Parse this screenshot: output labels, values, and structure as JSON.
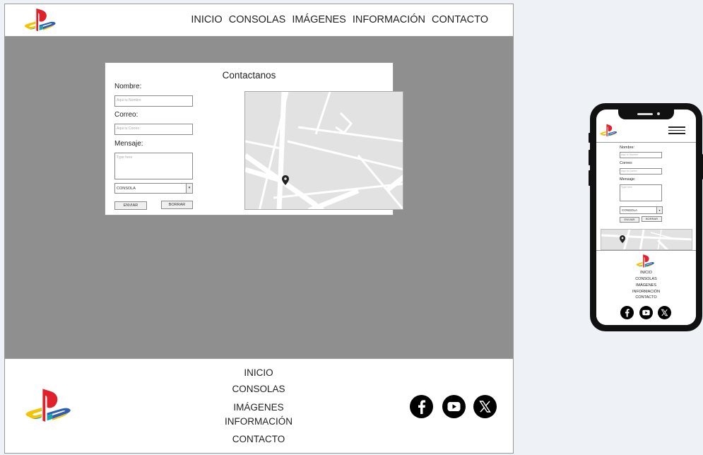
{
  "desktop": {
    "header": {
      "logo_icon": "playstation-logo-icon",
      "nav": [
        "INICIO",
        "CONSOLAS",
        "IMÁGENES",
        "INFORMACIÓN",
        "CONTACTO"
      ]
    },
    "form": {
      "title": "Contactanos",
      "name_label": "Nombre:",
      "name_placeholder": "Aqui tu Nombre",
      "email_label": "Correo:",
      "email_placeholder": "Aqui tu Correo",
      "message_label": "Mensaje:",
      "message_placeholder": "Type here",
      "select_value": "CONSOLA",
      "send_label": "ENVIAR",
      "clear_label": "BORRAR"
    },
    "map_icon": "location-pin-icon",
    "footer": {
      "logo_icon": "playstation-logo-icon",
      "links": [
        "INICIO",
        "CONSOLAS",
        "IMÁGENES",
        "INFORMACIÓN",
        "CONTACTO"
      ],
      "social_icons": [
        "facebook-icon",
        "youtube-icon",
        "x-twitter-icon"
      ]
    }
  },
  "mobile": {
    "header": {
      "logo_icon": "playstation-logo-icon",
      "menu_icon": "hamburger-menu-icon"
    },
    "form": {
      "name_label": "Nombre:",
      "name_placeholder": "Aqui tu Nombre",
      "email_label": "Correo:",
      "email_placeholder": "Aqui tu Correo",
      "message_label": "Mensaje:",
      "message_placeholder": "Type here",
      "select_value": "CONSOLA",
      "send_label": "ENVIAR",
      "clear_label": "BORRAR"
    },
    "footer": {
      "links": [
        "INICIO",
        "CONSOLAS",
        "IMÁGENES",
        "INFORMACIÓN",
        "CONTACTO"
      ],
      "social_icons": [
        "facebook-icon",
        "youtube-icon",
        "x-twitter-icon"
      ]
    }
  },
  "colors": {
    "page_bg": "#eef1f6",
    "main_bg": "#8f8f8f",
    "ps_red": "#e0202b",
    "ps_yellow": "#f5c400",
    "ps_teal": "#19a3a8",
    "ps_blue": "#2d5db8"
  }
}
